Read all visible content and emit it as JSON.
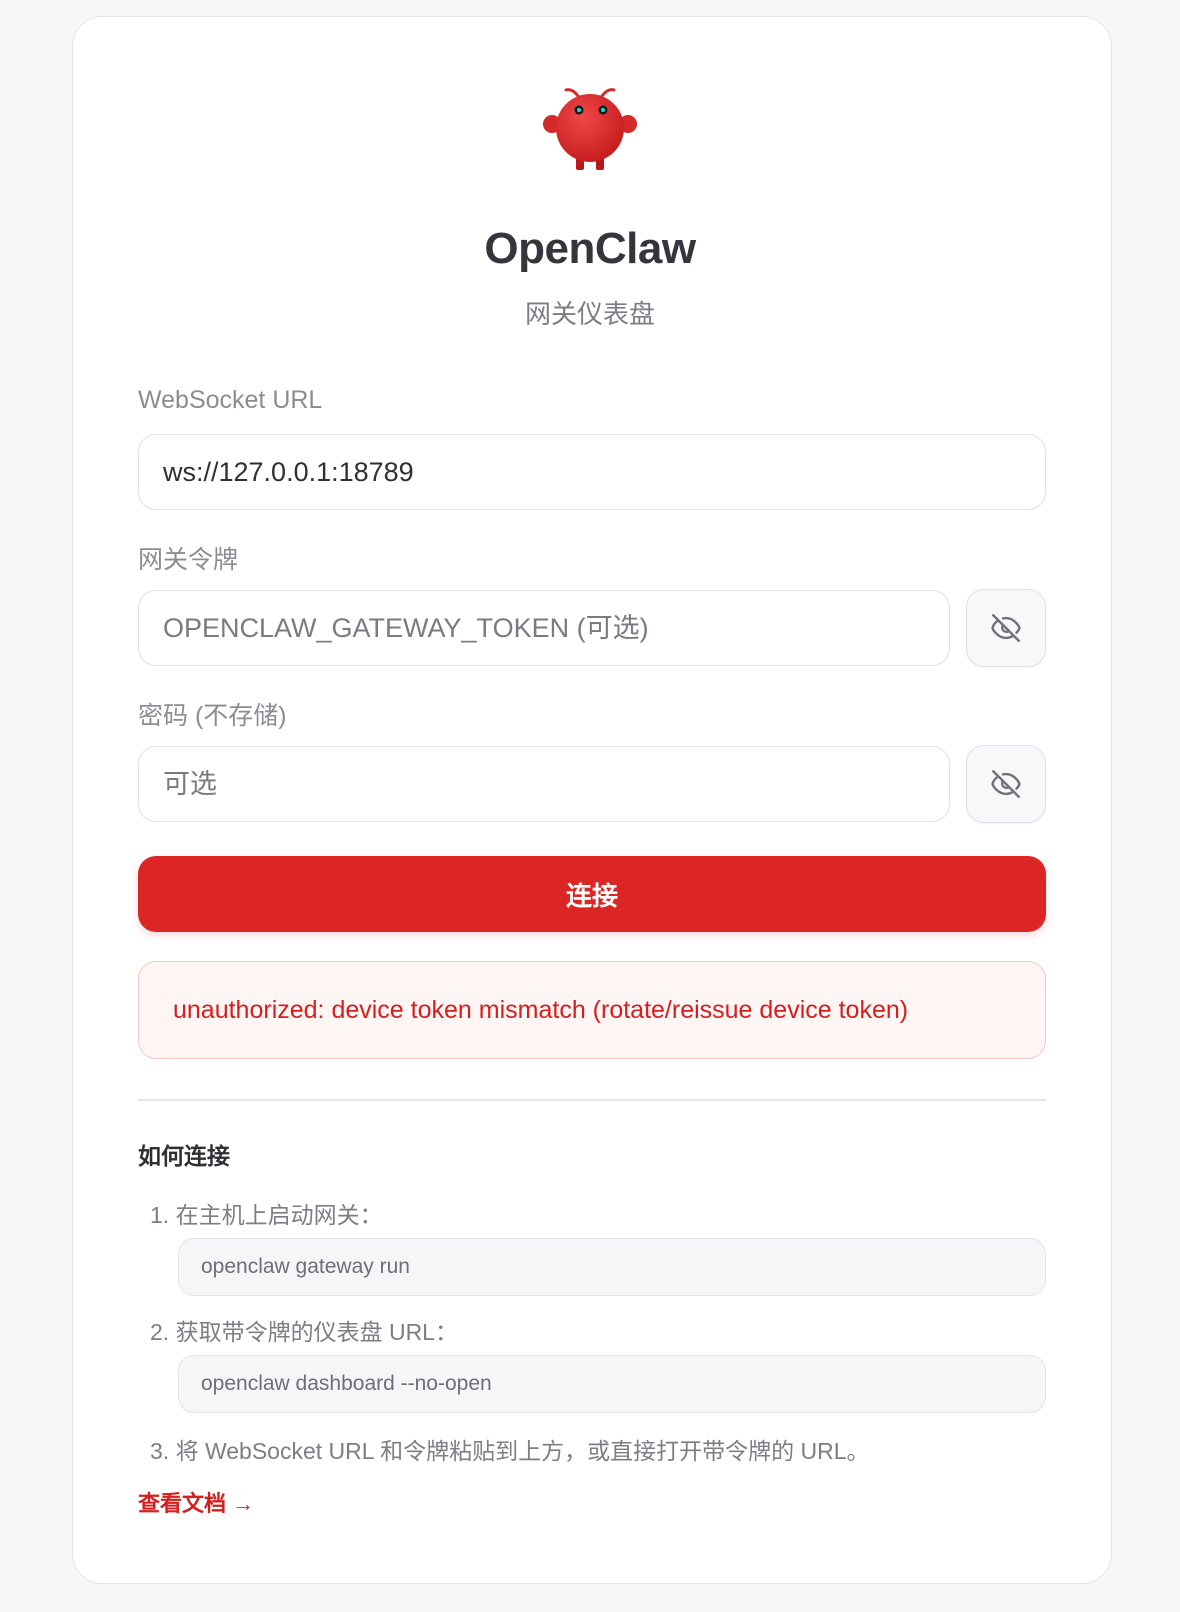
{
  "app": {
    "title": "OpenClaw",
    "subtitle": "网关仪表盘"
  },
  "form": {
    "ws_label": "WebSocket URL",
    "ws_value": "ws://127.0.0.1:18789",
    "token_label": "网关令牌",
    "token_placeholder": "OPENCLAW_GATEWAY_TOKEN (可选)",
    "password_label": "密码 (不存储)",
    "password_placeholder": "可选",
    "connect_label": "连接"
  },
  "error": {
    "message": "unauthorized: device token mismatch (rotate/reissue device token)"
  },
  "help": {
    "title": "如何连接",
    "steps": [
      {
        "text": "1. 在主机上启动网关：",
        "code": "openclaw gateway run"
      },
      {
        "text": "2. 获取带令牌的仪表盘 URL：",
        "code": "openclaw dashboard --no-open"
      },
      {
        "text": "3. 将 WebSocket URL 和令牌粘贴到上方，或直接打开带令牌的 URL。"
      }
    ],
    "docs_link": "查看文档 →"
  },
  "icons": {
    "logo": "openclaw-mascot-icon",
    "token_toggle": "eye-off-icon",
    "password_toggle": "eye-off-icon"
  },
  "colors": {
    "accent": "#dc2626",
    "error_text": "#d41f1f",
    "error_bg": "#fef5f5",
    "error_border": "#f7c6c6"
  }
}
